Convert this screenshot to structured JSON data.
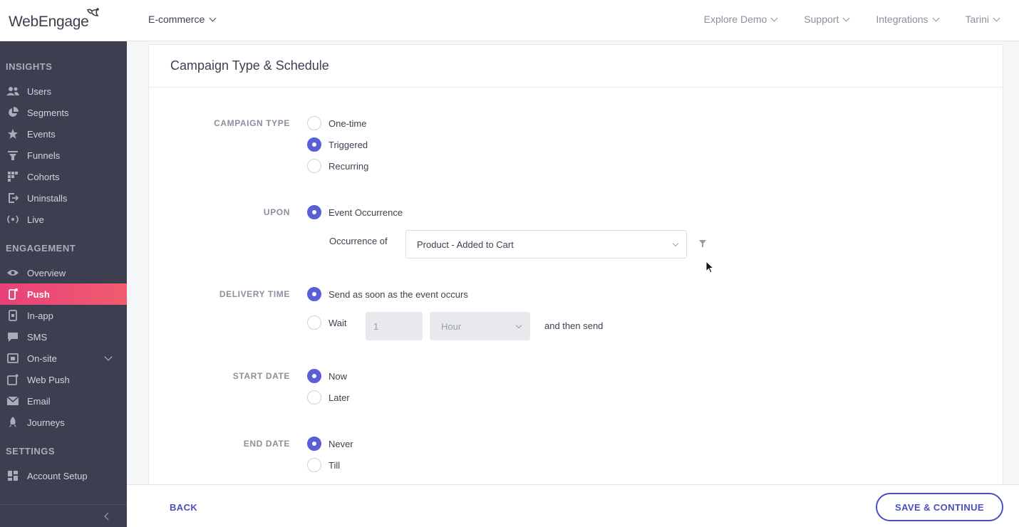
{
  "app": {
    "logo_text": "WebEngage",
    "project": "E-commerce"
  },
  "topnav": [
    {
      "label": "Explore Demo"
    },
    {
      "label": "Support"
    },
    {
      "label": "Integrations"
    },
    {
      "label": "Tarini"
    }
  ],
  "sidebar": {
    "sections": {
      "insights": "INSIGHTS",
      "engagement": "ENGAGEMENT",
      "settings": "SETTINGS"
    },
    "insights_items": [
      {
        "label": "Users",
        "icon": "users-icon"
      },
      {
        "label": "Segments",
        "icon": "pie-chart-icon"
      },
      {
        "label": "Events",
        "icon": "star-icon"
      },
      {
        "label": "Funnels",
        "icon": "funnel-icon"
      },
      {
        "label": "Cohorts",
        "icon": "grid-dots-icon"
      },
      {
        "label": "Uninstalls",
        "icon": "exit-icon"
      },
      {
        "label": "Live",
        "icon": "broadcast-icon"
      }
    ],
    "engagement_items": [
      {
        "label": "Overview",
        "icon": "eye-icon"
      },
      {
        "label": "Push",
        "icon": "mobile-icon",
        "active": true
      },
      {
        "label": "In-app",
        "icon": "in-app-icon"
      },
      {
        "label": "SMS",
        "icon": "chat-icon"
      },
      {
        "label": "On-site",
        "icon": "window-icon"
      },
      {
        "label": "Web Push",
        "icon": "browser-icon"
      },
      {
        "label": "Email",
        "icon": "envelope-icon"
      },
      {
        "label": "Journeys",
        "icon": "rocket-icon"
      }
    ],
    "settings_items": [
      {
        "label": "Account Setup",
        "icon": "dashboard-icon"
      }
    ]
  },
  "card": {
    "title": "Campaign Type & Schedule",
    "campaign_type": {
      "label": "CAMPAIGN TYPE",
      "options": [
        "One-time",
        "Triggered",
        "Recurring"
      ],
      "selected": "Triggered"
    },
    "upon": {
      "label": "UPON",
      "option": "Event Occurrence",
      "occurrence_label": "Occurrence of",
      "event_value": "Product - Added to Cart"
    },
    "delivery_time": {
      "label": "DELIVERY TIME",
      "option_now": "Send as soon as the event occurs",
      "option_wait": "Wait",
      "wait_value": "1",
      "wait_unit": "Hour",
      "suffix": "and then send"
    },
    "start_date": {
      "label": "START DATE",
      "options": [
        "Now",
        "Later"
      ],
      "selected": "Now"
    },
    "end_date": {
      "label": "END DATE",
      "options": [
        "Never",
        "Till"
      ],
      "selected": "Never"
    }
  },
  "footer": {
    "back_label": "BACK",
    "save_label": "SAVE & CONTINUE"
  },
  "colors": {
    "accent": "#5a5fd6",
    "button": "#4a4fbf",
    "sidebar_bg": "#3b3f4f",
    "active_pink": "#e8417a"
  }
}
